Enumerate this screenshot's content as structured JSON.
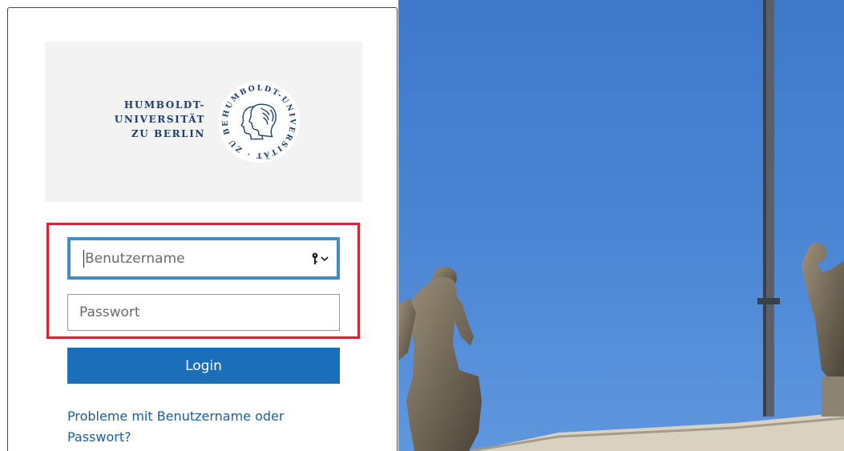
{
  "logo": {
    "line1": "HUMBOLDT-",
    "line2": "UNIVERSITÄT",
    "line3": "ZU BERLIN",
    "seal_text": "HUMBOLDT-UNIVERSITÄT · ZU BERLIN ·",
    "color": "#1b3f6e"
  },
  "login_form": {
    "username_placeholder": "Benutzername",
    "password_placeholder": "Passwort",
    "login_label": "Login",
    "help_link": "Probleme mit Benutzername oder Passwort?",
    "password_manager_icon": "key-icon",
    "accent": "#1a6fb8",
    "focus_border": "#3c8dcb",
    "highlight_color": "#d32630"
  },
  "background": {
    "description_icon": "statue-photo",
    "sky_color": "#4a80cf"
  }
}
